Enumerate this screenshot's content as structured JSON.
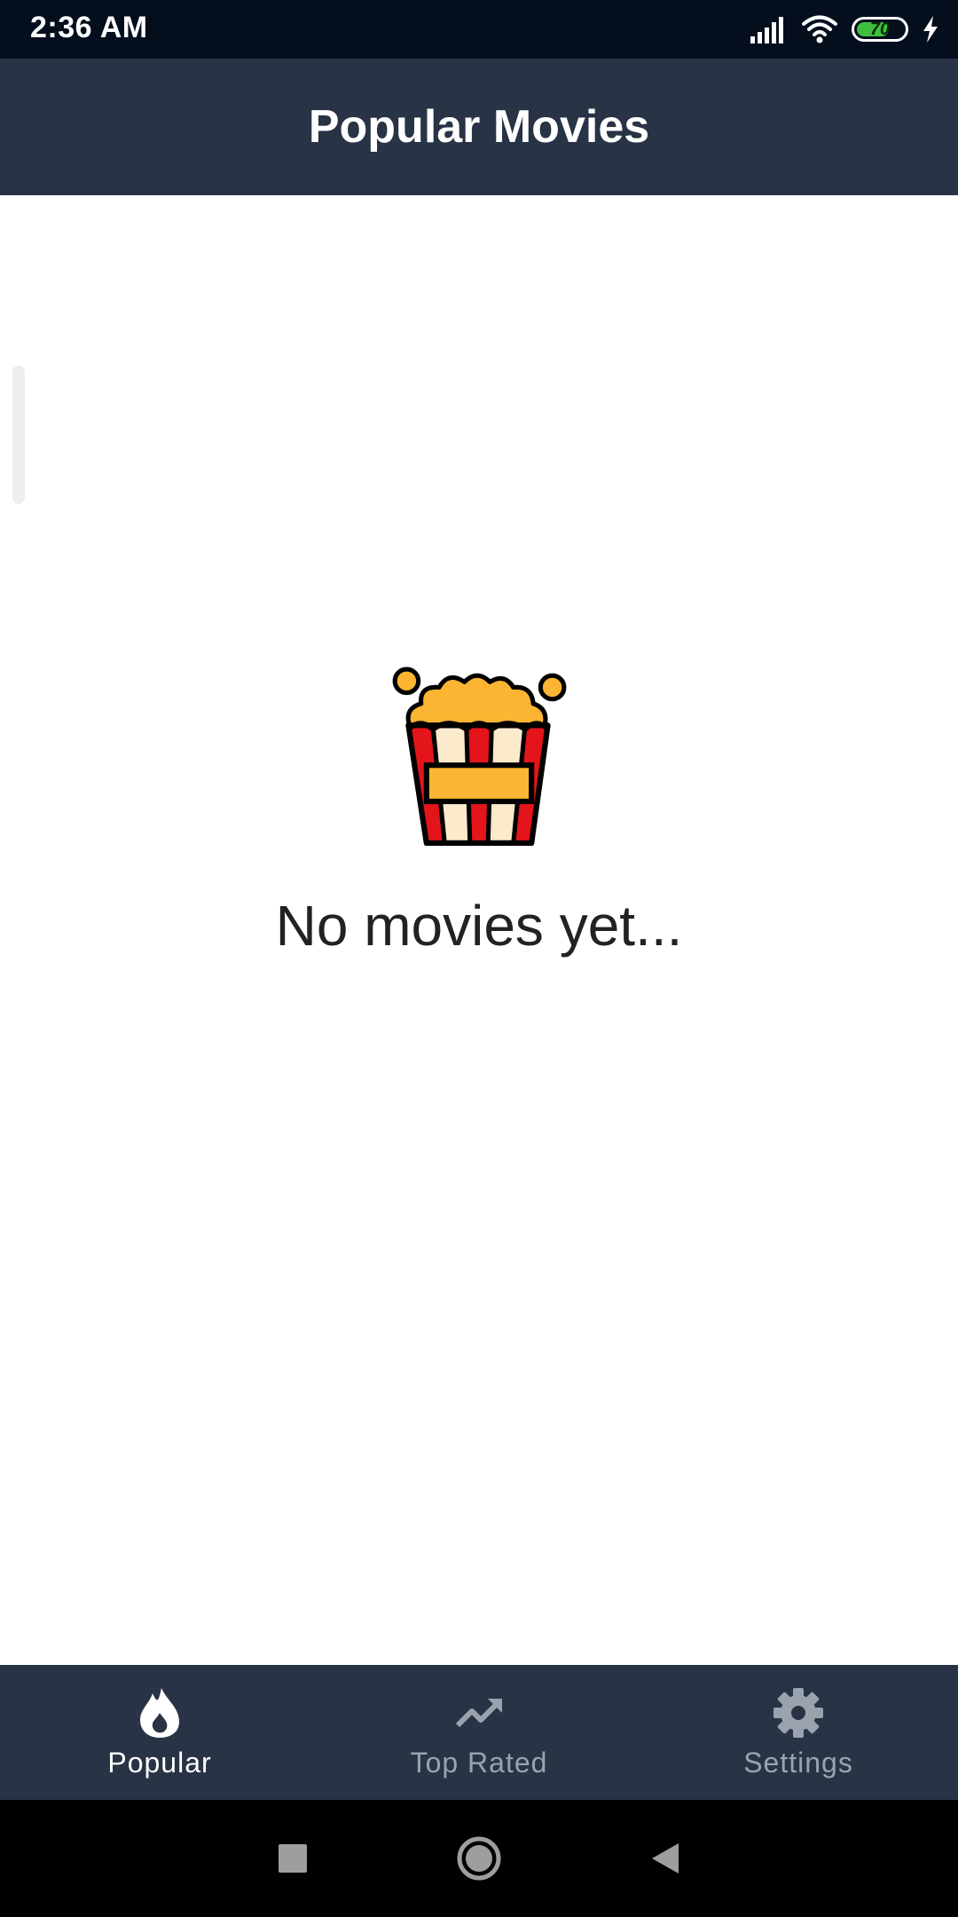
{
  "status_bar": {
    "time": "2:36 AM",
    "battery_level": "70",
    "icons": [
      "signal-icon",
      "wifi-icon",
      "battery-icon",
      "charging-icon"
    ]
  },
  "app_bar": {
    "title": "Popular Movies"
  },
  "empty_state": {
    "message": "No movies yet...",
    "icon": "popcorn-icon"
  },
  "bottom_nav": {
    "items": [
      {
        "label": "Popular",
        "icon": "flame-icon",
        "active": true
      },
      {
        "label": "Top Rated",
        "icon": "trending-up-icon",
        "active": false
      },
      {
        "label": "Settings",
        "icon": "gear-icon",
        "active": false
      }
    ]
  },
  "system_nav": {
    "buttons": [
      "recents-button",
      "home-button",
      "back-button"
    ]
  },
  "colors": {
    "bar_background": "#283345",
    "status_background": "#050e1d",
    "active_nav": "#ffffff",
    "inactive_nav": "#9aa3ad",
    "popcorn_red": "#e3151b",
    "popcorn_yellow": "#fbb532"
  }
}
